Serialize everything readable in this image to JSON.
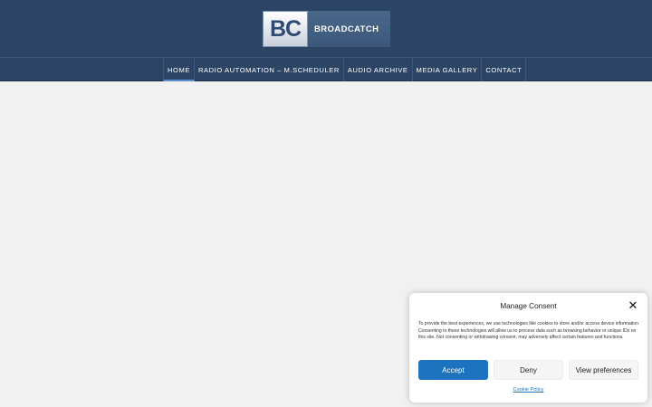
{
  "logo": {
    "mark": "BC",
    "text": "BROADCATCH"
  },
  "nav": {
    "items": [
      {
        "label": "HOME",
        "active": true
      },
      {
        "label": "RADIO AUTOMATION – M.SCHEDULER",
        "active": false
      },
      {
        "label": "AUDIO ARCHIVE",
        "active": false
      },
      {
        "label": "MEDIA GALLERY",
        "active": false
      },
      {
        "label": "CONTACT",
        "active": false
      }
    ]
  },
  "consent": {
    "title": "Manage Consent",
    "close_icon": "close-icon",
    "body": "To provide the best experiences, we use technologies like cookies to store and/or access device information. Consenting to these technologies will allow us to process data such as browsing behavior or unique IDs on this site. Not consenting or withdrawing consent, may adversely affect certain features and functions.",
    "accept_label": "Accept",
    "deny_label": "Deny",
    "preferences_label": "View preferences",
    "cookie_policy_label": "Cookie Policy"
  },
  "colors": {
    "header_bg": "#2d4564",
    "page_bg": "#f1f1f1",
    "accent": "#1e73be"
  }
}
